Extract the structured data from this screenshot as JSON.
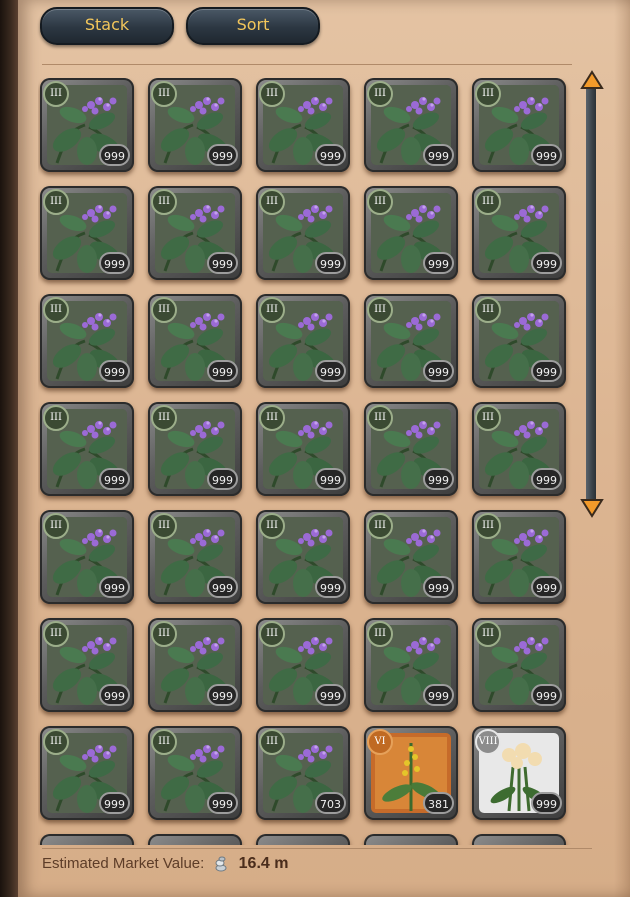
{
  "toolbar": {
    "stack_label": "Stack",
    "sort_label": "Sort"
  },
  "items": [
    {
      "tier": "III",
      "qty": "999",
      "kind": "comfrey"
    },
    {
      "tier": "III",
      "qty": "999",
      "kind": "comfrey"
    },
    {
      "tier": "III",
      "qty": "999",
      "kind": "comfrey"
    },
    {
      "tier": "III",
      "qty": "999",
      "kind": "comfrey"
    },
    {
      "tier": "III",
      "qty": "999",
      "kind": "comfrey"
    },
    {
      "tier": "III",
      "qty": "999",
      "kind": "comfrey"
    },
    {
      "tier": "III",
      "qty": "999",
      "kind": "comfrey"
    },
    {
      "tier": "III",
      "qty": "999",
      "kind": "comfrey"
    },
    {
      "tier": "III",
      "qty": "999",
      "kind": "comfrey"
    },
    {
      "tier": "III",
      "qty": "999",
      "kind": "comfrey"
    },
    {
      "tier": "III",
      "qty": "999",
      "kind": "comfrey"
    },
    {
      "tier": "III",
      "qty": "999",
      "kind": "comfrey"
    },
    {
      "tier": "III",
      "qty": "999",
      "kind": "comfrey"
    },
    {
      "tier": "III",
      "qty": "999",
      "kind": "comfrey"
    },
    {
      "tier": "III",
      "qty": "999",
      "kind": "comfrey"
    },
    {
      "tier": "III",
      "qty": "999",
      "kind": "comfrey"
    },
    {
      "tier": "III",
      "qty": "999",
      "kind": "comfrey"
    },
    {
      "tier": "III",
      "qty": "999",
      "kind": "comfrey"
    },
    {
      "tier": "III",
      "qty": "999",
      "kind": "comfrey"
    },
    {
      "tier": "III",
      "qty": "999",
      "kind": "comfrey"
    },
    {
      "tier": "III",
      "qty": "999",
      "kind": "comfrey"
    },
    {
      "tier": "III",
      "qty": "999",
      "kind": "comfrey"
    },
    {
      "tier": "III",
      "qty": "999",
      "kind": "comfrey"
    },
    {
      "tier": "III",
      "qty": "999",
      "kind": "comfrey"
    },
    {
      "tier": "III",
      "qty": "999",
      "kind": "comfrey"
    },
    {
      "tier": "III",
      "qty": "999",
      "kind": "comfrey"
    },
    {
      "tier": "III",
      "qty": "999",
      "kind": "comfrey"
    },
    {
      "tier": "III",
      "qty": "999",
      "kind": "comfrey"
    },
    {
      "tier": "III",
      "qty": "999",
      "kind": "comfrey"
    },
    {
      "tier": "III",
      "qty": "999",
      "kind": "comfrey"
    },
    {
      "tier": "III",
      "qty": "999",
      "kind": "comfrey"
    },
    {
      "tier": "III",
      "qty": "999",
      "kind": "comfrey"
    },
    {
      "tier": "III",
      "qty": "703",
      "kind": "comfrey"
    },
    {
      "tier": "VI",
      "qty": "381",
      "kind": "mullein"
    },
    {
      "tier": "VIII",
      "qty": "999",
      "kind": "yarrow"
    }
  ],
  "icons": {
    "scroll_up": "chevron-up-icon",
    "scroll_down": "chevron-down-icon",
    "currency": "silver-coin-icon"
  },
  "colors": {
    "button_text": "#f2c65b",
    "panel_bg": "#dcb592",
    "tier_badge_t3": "#3b4a33",
    "tier_badge_t6": "#c06a23",
    "tier_badge_t8": "#8c8c8c"
  },
  "footer": {
    "market_label": "Estimated Market Value:",
    "market_value": "16.4 m"
  }
}
